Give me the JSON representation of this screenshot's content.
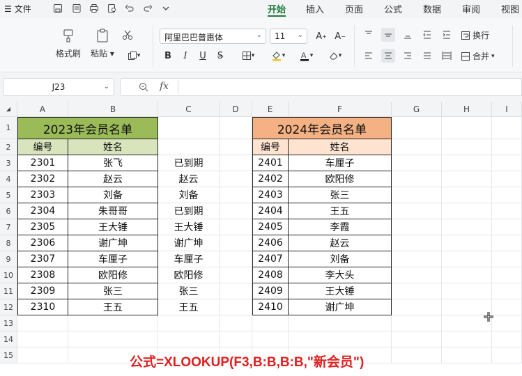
{
  "topbar": {
    "file_label": "文件",
    "tabs": [
      "开始",
      "插入",
      "页面",
      "公式",
      "数据",
      "审阅",
      "视图"
    ]
  },
  "ribbon": {
    "format_painter": "格式刷",
    "paste": "粘贴",
    "font_name": "阿里巴巴普惠体",
    "font_size": "11",
    "wrap_text": "换行",
    "merge": "合并"
  },
  "formula_bar": {
    "cell_ref": "J23",
    "fx_label": "fx",
    "content": ""
  },
  "columns": [
    "A",
    "B",
    "C",
    "D",
    "E",
    "F",
    "G",
    "H",
    "I"
  ],
  "rows": [
    "1",
    "2",
    "3",
    "4",
    "5",
    "6",
    "7",
    "8",
    "9",
    "10",
    "11",
    "12",
    "13",
    "14",
    "15"
  ],
  "table2023": {
    "title": "2023年会员名单",
    "headers": [
      "编号",
      "姓名"
    ],
    "rows": [
      [
        "2301",
        "张飞"
      ],
      [
        "2302",
        "赵云"
      ],
      [
        "2303",
        "刘备"
      ],
      [
        "2304",
        "朱哥哥"
      ],
      [
        "2305",
        "王大锤"
      ],
      [
        "2306",
        "谢广坤"
      ],
      [
        "2307",
        "车厘子"
      ],
      [
        "2308",
        "欧阳修"
      ],
      [
        "2309",
        "张三"
      ],
      [
        "2310",
        "王五"
      ]
    ]
  },
  "colC": [
    "已到期",
    "赵云",
    "刘备",
    "已到期",
    "王大锤",
    "谢广坤",
    "车厘子",
    "欧阳修",
    "张三",
    "王五"
  ],
  "table2024": {
    "title": "2024年会员名单",
    "headers": [
      "编号",
      "姓名"
    ],
    "rows": [
      [
        "2401",
        "车厘子"
      ],
      [
        "2402",
        "欧阳修"
      ],
      [
        "2403",
        "张三"
      ],
      [
        "2404",
        "王五"
      ],
      [
        "2405",
        "李霞"
      ],
      [
        "2406",
        "赵云"
      ],
      [
        "2407",
        "刘备"
      ],
      [
        "2408",
        "李大头"
      ],
      [
        "2409",
        "王大锤"
      ],
      [
        "2410",
        "谢广坤"
      ]
    ]
  },
  "annotation": "公式=XLOOKUP(F3,B:B,B:B,\"新会员\")"
}
